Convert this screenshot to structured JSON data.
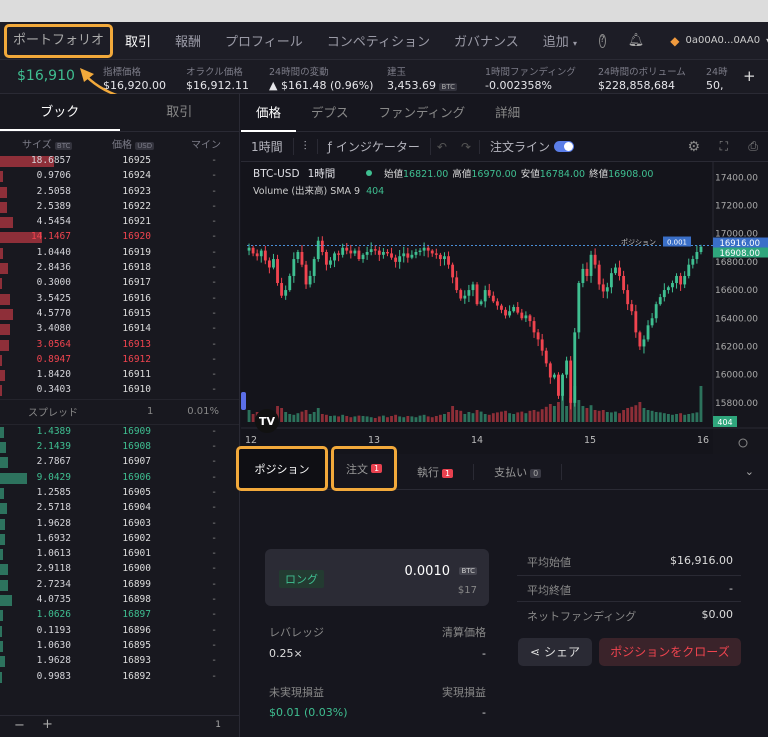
{
  "nav": {
    "portfolio": "ポートフォリオ",
    "trade": "取引",
    "rewards": "報酬",
    "profile": "プロフィール",
    "competition": "コンペティション",
    "governance": "ガバナンス",
    "more": "追加",
    "wallet": "0a00A0...0AA0"
  },
  "stats": {
    "price": "$16,910",
    "index_label": "指標価格",
    "index_value": "$16,920.00",
    "oracle_label": "オラクル価格",
    "oracle_value": "$16,912.11",
    "change_label": "24時間の変動",
    "change_value": "▲ $161.48 (0.96%)",
    "oi_label": "建玉",
    "oi_value": "3,453.69",
    "oi_unit": "BTC",
    "funding_label": "1時間ファンディング",
    "funding_value": "-0.002358%",
    "volume_label": "24時間のボリューム",
    "volume_value": "$228,858,684",
    "trades_label": "24時",
    "trades_value": "50,"
  },
  "book": {
    "tab_book": "ブック",
    "tab_trades": "取引",
    "col_size": "サイズ",
    "col_size_unit": "BTC",
    "col_price": "価格",
    "col_price_unit": "USD",
    "col_mine": "マイン",
    "asks": [
      {
        "size": "18.6857",
        "price": "16925",
        "mine": "-",
        "depth": 0.9
      },
      {
        "size": "0.9706",
        "price": "16924",
        "mine": "-",
        "depth": 0.05
      },
      {
        "size": "2.5058",
        "price": "16923",
        "mine": "-",
        "depth": 0.12
      },
      {
        "size": "2.5389",
        "price": "16922",
        "mine": "-",
        "depth": 0.12
      },
      {
        "size": "4.5454",
        "price": "16921",
        "mine": "-",
        "depth": 0.22
      },
      {
        "size": "14.1467",
        "price": "16920",
        "mine": "-",
        "depth": 0.7,
        "flash": true
      },
      {
        "size": "1.0440",
        "price": "16919",
        "mine": "-",
        "depth": 0.05
      },
      {
        "size": "2.8436",
        "price": "16918",
        "mine": "-",
        "depth": 0.14
      },
      {
        "size": "0.3000",
        "price": "16917",
        "mine": "-",
        "depth": 0.02
      },
      {
        "size": "3.5425",
        "price": "16916",
        "mine": "-",
        "depth": 0.17
      },
      {
        "size": "4.5770",
        "price": "16915",
        "mine": "-",
        "depth": 0.22
      },
      {
        "size": "3.4080",
        "price": "16914",
        "mine": "-",
        "depth": 0.16
      },
      {
        "size": "3.0564",
        "price": "16913",
        "mine": "-",
        "depth": 0.15,
        "flash": true
      },
      {
        "size": "0.8947",
        "price": "16912",
        "mine": "-",
        "depth": 0.04,
        "flash": true
      },
      {
        "size": "1.8420",
        "price": "16911",
        "mine": "-",
        "depth": 0.09
      },
      {
        "size": "0.3403",
        "price": "16910",
        "mine": "-",
        "depth": 0.02
      }
    ],
    "spread_label": "スプレッド",
    "spread_value": "1",
    "spread_pct": "0.01%",
    "bids": [
      {
        "size": "1.4389",
        "price": "16909",
        "mine": "-",
        "depth": 0.07,
        "flash": true
      },
      {
        "size": "2.1439",
        "price": "16908",
        "mine": "-",
        "depth": 0.1,
        "flash": true
      },
      {
        "size": "2.7867",
        "price": "16907",
        "mine": "-",
        "depth": 0.13
      },
      {
        "size": "9.0429",
        "price": "16906",
        "mine": "-",
        "depth": 0.45,
        "flash": true
      },
      {
        "size": "1.2585",
        "price": "16905",
        "mine": "-",
        "depth": 0.06
      },
      {
        "size": "2.5718",
        "price": "16904",
        "mine": "-",
        "depth": 0.12
      },
      {
        "size": "1.9628",
        "price": "16903",
        "mine": "-",
        "depth": 0.09
      },
      {
        "size": "1.6932",
        "price": "16902",
        "mine": "-",
        "depth": 0.08
      },
      {
        "size": "1.0613",
        "price": "16901",
        "mine": "-",
        "depth": 0.05
      },
      {
        "size": "2.9118",
        "price": "16900",
        "mine": "-",
        "depth": 0.14
      },
      {
        "size": "2.7234",
        "price": "16899",
        "mine": "-",
        "depth": 0.13
      },
      {
        "size": "4.0735",
        "price": "16898",
        "mine": "-",
        "depth": 0.2
      },
      {
        "size": "1.0626",
        "price": "16897",
        "mine": "-",
        "depth": 0.05,
        "flash": true
      },
      {
        "size": "0.1193",
        "price": "16896",
        "mine": "-",
        "depth": 0.01
      },
      {
        "size": "1.0630",
        "price": "16895",
        "mine": "-",
        "depth": 0.05
      },
      {
        "size": "1.9628",
        "price": "16893",
        "mine": "-",
        "depth": 0.09
      },
      {
        "size": "0.9983",
        "price": "16892",
        "mine": "-",
        "depth": 0.04
      }
    ],
    "zoom_minus": "−",
    "zoom_plus": "+",
    "zoom_value": "1"
  },
  "chart_tabs": [
    "価格",
    "デプス",
    "ファンディング",
    "詳細"
  ],
  "toolbar": {
    "interval": "1時間",
    "indicators": "インジケーター",
    "order_lines": "注文ライン"
  },
  "chart_data": {
    "type": "candlestick",
    "symbol": "BTC-USD",
    "interval": "1時間",
    "ohlc_label": {
      "open_l": "始値",
      "open": "16821.00",
      "high_l": "高値",
      "high": "16970.00",
      "low_l": "安値",
      "low": "16784.00",
      "close_l": "終値",
      "close": "16908.00"
    },
    "volume_label": "Volume (出来高)  SMA 9",
    "volume_value": "404",
    "ylim": [
      15650,
      17480
    ],
    "yticks": [
      "17400.00",
      "17200.00",
      "17000.00",
      "16800.00",
      "16600.00",
      "16400.00",
      "16200.00",
      "16000.00",
      "15800.00"
    ],
    "xticks": [
      "12",
      "13",
      "14",
      "15",
      "16"
    ],
    "position_label": "ポジション",
    "position_size": "0.001",
    "price_tag_high": "16916.00",
    "price_tag_close": "16908.00",
    "volume_tag": "404",
    "closes": [
      16900,
      16860,
      16840,
      16880,
      16810,
      16760,
      16820,
      16650,
      16560,
      16600,
      16700,
      16820,
      16870,
      16780,
      16640,
      16700,
      16820,
      16950,
      16870,
      16780,
      16810,
      16860,
      16850,
      16900,
      16880,
      16860,
      16880,
      16820,
      16850,
      16870,
      16890,
      16880,
      16850,
      16870,
      16860,
      16830,
      16800,
      16840,
      16860,
      16830,
      16850,
      16870,
      16880,
      16900,
      16880,
      16860,
      16850,
      16820,
      16840,
      16780,
      16690,
      16600,
      16540,
      16560,
      16600,
      16640,
      16500,
      16520,
      16600,
      16560,
      16520,
      16490,
      16460,
      16420,
      16450,
      16480,
      16440,
      16400,
      16420,
      16380,
      16300,
      16250,
      16170,
      16080,
      15980,
      16000,
      15850,
      16000,
      16100,
      15800,
      16300,
      16650,
      16750,
      16700,
      16850,
      16780,
      16640,
      16590,
      16620,
      16720,
      16760,
      16700,
      16600,
      16500,
      16450,
      16300,
      16200,
      16250,
      16350,
      16400,
      16500,
      16550,
      16600,
      16620,
      16650,
      16700,
      16640,
      16700,
      16780,
      16820,
      16870,
      16908
    ],
    "volumes": [
      30,
      20,
      25,
      15,
      22,
      28,
      20,
      40,
      35,
      25,
      20,
      18,
      22,
      26,
      30,
      20,
      25,
      35,
      20,
      18,
      15,
      16,
      14,
      18,
      15,
      12,
      14,
      16,
      15,
      14,
      12,
      10,
      14,
      16,
      12,
      15,
      18,
      14,
      12,
      15,
      14,
      12,
      16,
      18,
      14,
      12,
      15,
      18,
      20,
      25,
      40,
      30,
      28,
      20,
      25,
      22,
      30,
      26,
      20,
      18,
      22,
      24,
      26,
      28,
      22,
      20,
      24,
      26,
      22,
      28,
      30,
      26,
      32,
      38,
      45,
      40,
      50,
      70,
      40,
      60,
      90,
      55,
      40,
      35,
      42,
      30,
      28,
      30,
      25,
      24,
      26,
      22,
      30,
      35,
      38,
      42,
      50,
      35,
      30,
      28,
      25,
      24,
      22,
      20,
      18,
      20,
      22,
      18,
      20,
      22,
      24,
      404
    ]
  },
  "bottom_tabs": {
    "position": "ポジション",
    "orders": "注文",
    "orders_count": "1",
    "fills": "執行",
    "fills_count": "1",
    "payments": "支払い",
    "payments_count": "0"
  },
  "position": {
    "side": "ロング",
    "size": "0.0010",
    "size_unit": "BTC",
    "notional": "$17",
    "leverage_label": "レバレッジ",
    "leverage": "0.25×",
    "liq_label": "清算価格",
    "liq": "-",
    "unrealized_label": "未実現損益",
    "unrealized": "$0.01 (0.03%)",
    "realized_label": "実現損益",
    "realized": "-",
    "avg_open_label": "平均始値",
    "avg_open": "$16,916.00",
    "avg_close_label": "平均終値",
    "avg_close": "-",
    "net_funding_label": "ネットファンディング",
    "net_funding": "$0.00",
    "share": "シェア",
    "close_position": "ポジションをクローズ"
  }
}
